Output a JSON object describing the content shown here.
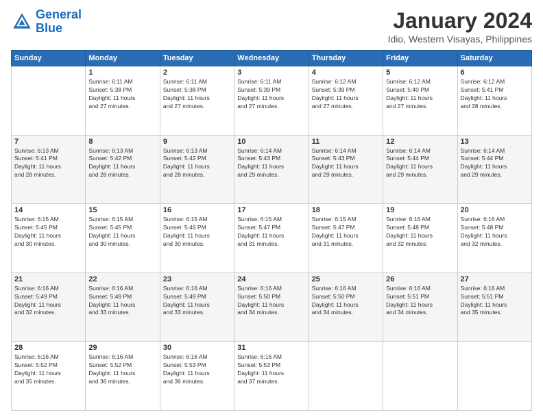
{
  "logo": {
    "line1": "General",
    "line2": "Blue"
  },
  "title": "January 2024",
  "location": "Idio, Western Visayas, Philippines",
  "days_of_week": [
    "Sunday",
    "Monday",
    "Tuesday",
    "Wednesday",
    "Thursday",
    "Friday",
    "Saturday"
  ],
  "weeks": [
    [
      {
        "day": "",
        "info": ""
      },
      {
        "day": "1",
        "info": "Sunrise: 6:11 AM\nSunset: 5:38 PM\nDaylight: 11 hours\nand 27 minutes."
      },
      {
        "day": "2",
        "info": "Sunrise: 6:11 AM\nSunset: 5:38 PM\nDaylight: 11 hours\nand 27 minutes."
      },
      {
        "day": "3",
        "info": "Sunrise: 6:11 AM\nSunset: 5:39 PM\nDaylight: 11 hours\nand 27 minutes."
      },
      {
        "day": "4",
        "info": "Sunrise: 6:12 AM\nSunset: 5:39 PM\nDaylight: 11 hours\nand 27 minutes."
      },
      {
        "day": "5",
        "info": "Sunrise: 6:12 AM\nSunset: 5:40 PM\nDaylight: 11 hours\nand 27 minutes."
      },
      {
        "day": "6",
        "info": "Sunrise: 6:12 AM\nSunset: 5:41 PM\nDaylight: 11 hours\nand 28 minutes."
      }
    ],
    [
      {
        "day": "7",
        "info": "Sunrise: 6:13 AM\nSunset: 5:41 PM\nDaylight: 11 hours\nand 28 minutes."
      },
      {
        "day": "8",
        "info": "Sunrise: 6:13 AM\nSunset: 5:42 PM\nDaylight: 11 hours\nand 28 minutes."
      },
      {
        "day": "9",
        "info": "Sunrise: 6:13 AM\nSunset: 5:42 PM\nDaylight: 11 hours\nand 28 minutes."
      },
      {
        "day": "10",
        "info": "Sunrise: 6:14 AM\nSunset: 5:43 PM\nDaylight: 11 hours\nand 29 minutes."
      },
      {
        "day": "11",
        "info": "Sunrise: 6:14 AM\nSunset: 5:43 PM\nDaylight: 11 hours\nand 29 minutes."
      },
      {
        "day": "12",
        "info": "Sunrise: 6:14 AM\nSunset: 5:44 PM\nDaylight: 11 hours\nand 29 minutes."
      },
      {
        "day": "13",
        "info": "Sunrise: 6:14 AM\nSunset: 5:44 PM\nDaylight: 11 hours\nand 29 minutes."
      }
    ],
    [
      {
        "day": "14",
        "info": "Sunrise: 6:15 AM\nSunset: 5:45 PM\nDaylight: 11 hours\nand 30 minutes."
      },
      {
        "day": "15",
        "info": "Sunrise: 6:15 AM\nSunset: 5:45 PM\nDaylight: 11 hours\nand 30 minutes."
      },
      {
        "day": "16",
        "info": "Sunrise: 6:15 AM\nSunset: 5:46 PM\nDaylight: 11 hours\nand 30 minutes."
      },
      {
        "day": "17",
        "info": "Sunrise: 6:15 AM\nSunset: 5:47 PM\nDaylight: 11 hours\nand 31 minutes."
      },
      {
        "day": "18",
        "info": "Sunrise: 6:15 AM\nSunset: 5:47 PM\nDaylight: 11 hours\nand 31 minutes."
      },
      {
        "day": "19",
        "info": "Sunrise: 6:16 AM\nSunset: 5:48 PM\nDaylight: 11 hours\nand 32 minutes."
      },
      {
        "day": "20",
        "info": "Sunrise: 6:16 AM\nSunset: 5:48 PM\nDaylight: 11 hours\nand 32 minutes."
      }
    ],
    [
      {
        "day": "21",
        "info": "Sunrise: 6:16 AM\nSunset: 5:49 PM\nDaylight: 11 hours\nand 32 minutes."
      },
      {
        "day": "22",
        "info": "Sunrise: 6:16 AM\nSunset: 5:49 PM\nDaylight: 11 hours\nand 33 minutes."
      },
      {
        "day": "23",
        "info": "Sunrise: 6:16 AM\nSunset: 5:49 PM\nDaylight: 11 hours\nand 33 minutes."
      },
      {
        "day": "24",
        "info": "Sunrise: 6:16 AM\nSunset: 5:50 PM\nDaylight: 11 hours\nand 34 minutes."
      },
      {
        "day": "25",
        "info": "Sunrise: 6:16 AM\nSunset: 5:50 PM\nDaylight: 11 hours\nand 34 minutes."
      },
      {
        "day": "26",
        "info": "Sunrise: 6:16 AM\nSunset: 5:51 PM\nDaylight: 11 hours\nand 34 minutes."
      },
      {
        "day": "27",
        "info": "Sunrise: 6:16 AM\nSunset: 5:51 PM\nDaylight: 11 hours\nand 35 minutes."
      }
    ],
    [
      {
        "day": "28",
        "info": "Sunrise: 6:16 AM\nSunset: 5:52 PM\nDaylight: 11 hours\nand 35 minutes."
      },
      {
        "day": "29",
        "info": "Sunrise: 6:16 AM\nSunset: 5:52 PM\nDaylight: 11 hours\nand 36 minutes."
      },
      {
        "day": "30",
        "info": "Sunrise: 6:16 AM\nSunset: 5:53 PM\nDaylight: 11 hours\nand 36 minutes."
      },
      {
        "day": "31",
        "info": "Sunrise: 6:16 AM\nSunset: 5:53 PM\nDaylight: 11 hours\nand 37 minutes."
      },
      {
        "day": "",
        "info": ""
      },
      {
        "day": "",
        "info": ""
      },
      {
        "day": "",
        "info": ""
      }
    ]
  ]
}
